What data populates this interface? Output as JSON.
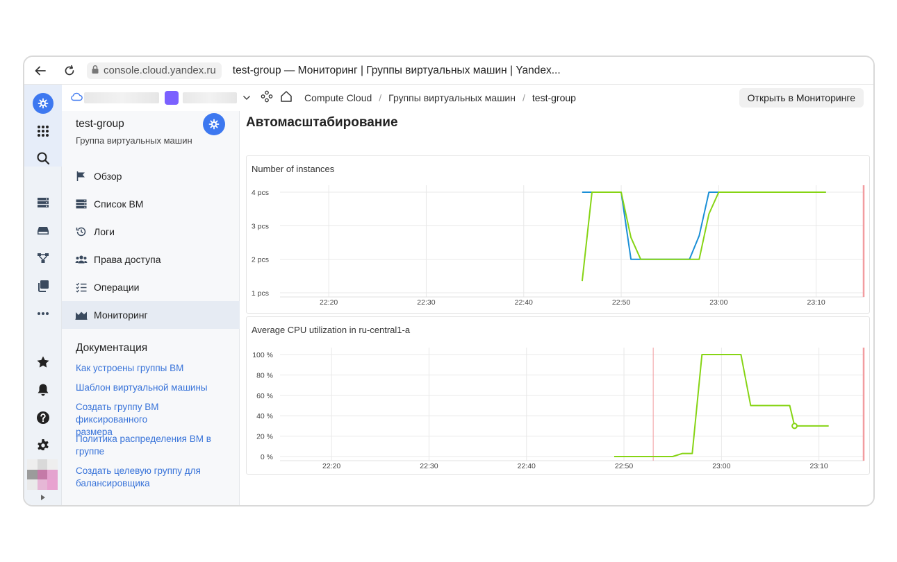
{
  "browser": {
    "url": "console.cloud.yandex.ru",
    "tab_title": "test-group — Мониторинг | Группы виртуальных машин | Yandex..."
  },
  "breadcrumbs": {
    "items": [
      "Compute Cloud",
      "Группы виртуальных машин"
    ],
    "current": "test-group"
  },
  "header": {
    "open_monitoring_label": "Открыть в Мониторинге"
  },
  "sidebar": {
    "title": "test-group",
    "subtitle": "Группа виртуальных машин",
    "items": [
      {
        "label": "Обзор",
        "icon": "flag-icon"
      },
      {
        "label": "Список ВМ",
        "icon": "server-list-icon"
      },
      {
        "label": "Логи",
        "icon": "history-icon"
      },
      {
        "label": "Права доступа",
        "icon": "persons-icon"
      },
      {
        "label": "Операции",
        "icon": "checklist-icon"
      },
      {
        "label": "Мониторинг",
        "icon": "chart-area-icon",
        "active": true
      }
    ],
    "docs_title": "Документация",
    "doc_links": [
      "Как устроены группы ВМ",
      "Шаблон виртуальной машины",
      "Создать группу ВМ фиксированного размера",
      "Политика распределения ВМ в группе",
      "Создать целевую группу для балансировщика"
    ]
  },
  "main": {
    "title": "Автомасштабирование"
  },
  "colors": {
    "accent": "#3d78f0",
    "link": "#3873d9",
    "series_blue": "#1a8fd6",
    "series_green": "#86d414",
    "now_marker": "#f29ca0"
  },
  "chart_data": [
    {
      "type": "line",
      "title": "Number of instances",
      "x_ticks": [
        "22:20",
        "22:30",
        "22:40",
        "22:50",
        "23:00",
        "23:10"
      ],
      "y_ticks": [
        "1 pcs",
        "2 pcs",
        "3 pcs",
        "4 pcs"
      ],
      "ylim": [
        1,
        4
      ],
      "series": [
        {
          "color": "#1a8fd6",
          "points": [
            [
              "22:46",
              4
            ],
            [
              "22:50",
              4
            ],
            [
              "22:51",
              2
            ],
            [
              "22:57",
              2
            ],
            [
              "22:58",
              2.7
            ],
            [
              "22:59",
              4
            ],
            [
              "23:11",
              4
            ]
          ]
        },
        {
          "color": "#86d414",
          "points": [
            [
              "22:46",
              1.35
            ],
            [
              "22:47",
              4
            ],
            [
              "22:50",
              4
            ],
            [
              "22:51",
              2.65
            ],
            [
              "22:52",
              2
            ],
            [
              "22:58",
              2
            ],
            [
              "22:59",
              3.35
            ],
            [
              "23:00",
              4
            ],
            [
              "23:11",
              4
            ]
          ]
        }
      ]
    },
    {
      "type": "line",
      "title": "Average CPU utilization in ru-central1-a",
      "x_ticks": [
        "22:20",
        "22:30",
        "22:40",
        "22:50",
        "23:00",
        "23:10"
      ],
      "y_ticks": [
        "0 %",
        "20 %",
        "40 %",
        "60 %",
        "80 %",
        "100 %"
      ],
      "ylim": [
        0,
        100
      ],
      "series": [
        {
          "color": "#86d414",
          "points": [
            [
              "22:49",
              0
            ],
            [
              "22:55",
              0
            ],
            [
              "22:56",
              3
            ],
            [
              "22:57",
              3
            ],
            [
              "22:58",
              100
            ],
            [
              "23:02",
              100
            ],
            [
              "23:03",
              50
            ],
            [
              "23:07",
              50
            ],
            [
              "23:07.5",
              30
            ],
            [
              "23:11",
              30
            ]
          ]
        }
      ]
    }
  ]
}
